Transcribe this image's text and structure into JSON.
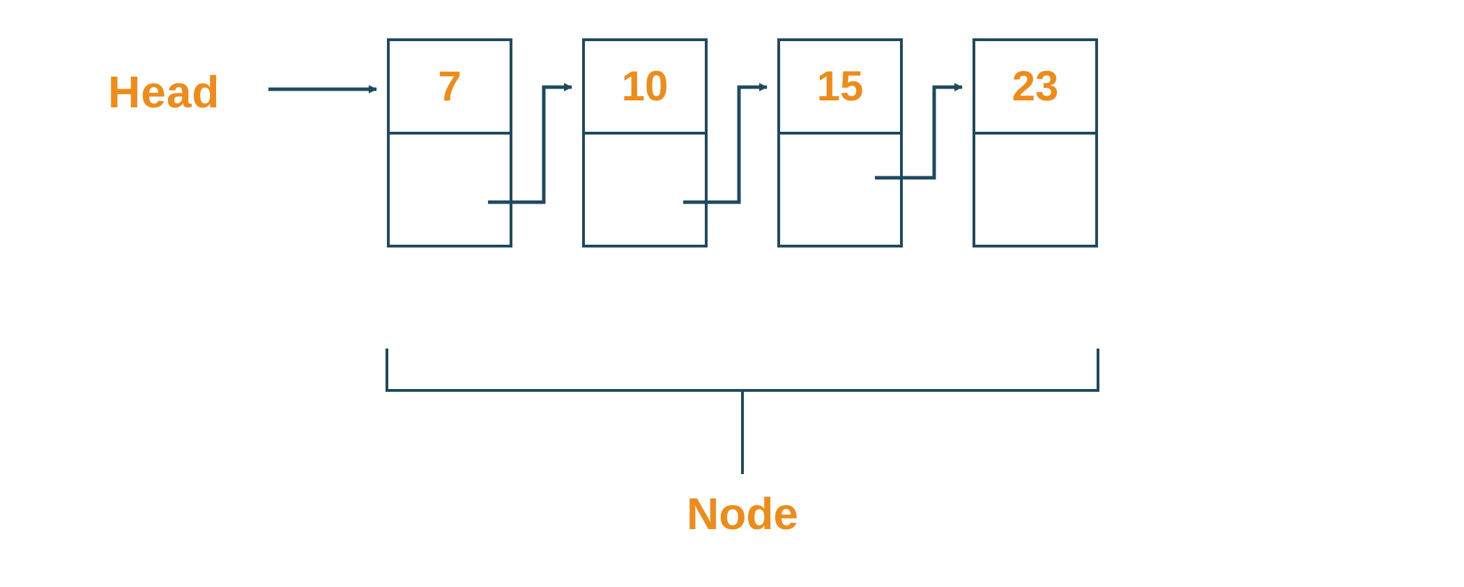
{
  "labels": {
    "head": "Head",
    "node": "Node"
  },
  "colors": {
    "accent": "#ee8c1b",
    "line": "#1d4a5e"
  },
  "nodes": [
    {
      "value": "7"
    },
    {
      "value": "10"
    },
    {
      "value": "15"
    },
    {
      "value": "23"
    }
  ]
}
